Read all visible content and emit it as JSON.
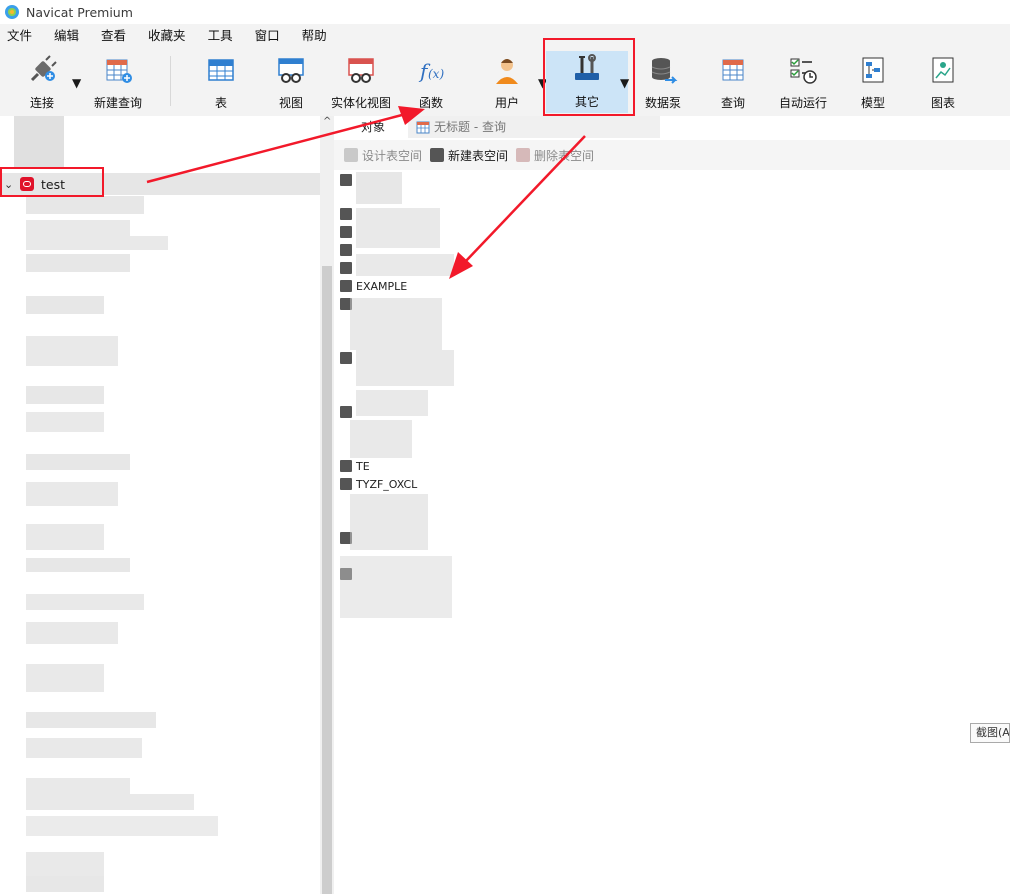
{
  "window": {
    "title": "Navicat Premium"
  },
  "menu": [
    "文件",
    "编辑",
    "查看",
    "收藏夹",
    "工具",
    "窗口",
    "帮助"
  ],
  "toolbar": {
    "connect": "连接",
    "new_query": "新建查询",
    "table": "表",
    "view": "视图",
    "mview": "实体化视图",
    "function": "函数",
    "user": "用户",
    "other": "其它",
    "datapump": "数据泵",
    "query": "查询",
    "autorun": "自动运行",
    "model": "模型",
    "chart": "图表"
  },
  "tabs": {
    "objects": "对象",
    "query": "无标题 - 查询"
  },
  "subtoolbar": {
    "design": "设计表空间",
    "new": "新建表空间",
    "delete": "删除表空间"
  },
  "tree": {
    "connection": "test"
  },
  "list_visible": [
    "EXAMPLE",
    "TE",
    "TYZF_OXCL"
  ],
  "tooltip": "截图(A",
  "colors": {
    "highlight": "#f2192a",
    "selected": "#cce4f7"
  }
}
